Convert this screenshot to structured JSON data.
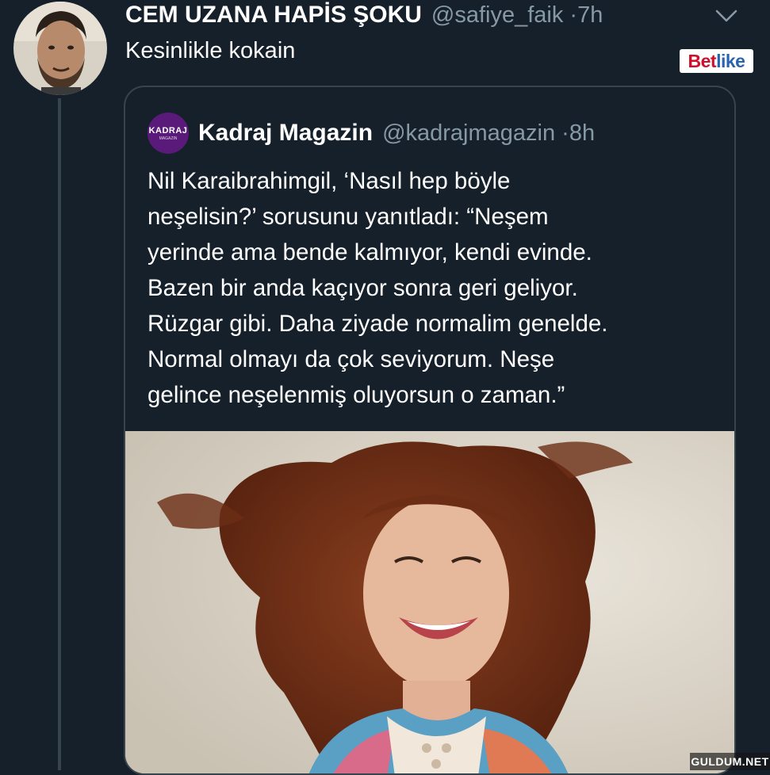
{
  "tweet": {
    "author_name": "CEM UZANA HAPİS ŞOKU",
    "author_handle": "@safiye_faik",
    "separator": "·",
    "time": "7h",
    "text": "Kesinlikle kokain",
    "menu_icon": "chevron-down-icon",
    "avatar_icon": "profile-photo"
  },
  "quoted_tweet": {
    "author_name": "Kadraj Magazin",
    "author_handle": "@kadrajmagazin",
    "separator": "·",
    "time": "8h",
    "avatar_text": "KADRAJ",
    "avatar_subtext": "MAGAZIN",
    "lines": [
      "Nil Karaibrahimgil, ‘Nasıl hep böyle",
      "neşelisin?’ sorusunu yanıtladı: “Neşem",
      "yerinde ama bende kalmıyor, kendi evinde.",
      "Bazen bir anda kaçıyor sonra geri geliyor.",
      "Rüzgar gibi. Daha ziyade normalim genelde.",
      "Normal olmayı da çok seviyorum. Neşe",
      "gelince neşelenmiş oluyorsun o zaman.”"
    ],
    "photo_icon": "attached-photo"
  },
  "watermarks": {
    "betlike_bet": "Bet",
    "betlike_like": "like",
    "guldum": "GULDUM.NET"
  },
  "colors": {
    "background": "#15202b",
    "secondary_text": "#8899a6",
    "border": "#38444d",
    "primary_text": "#ffffff"
  }
}
